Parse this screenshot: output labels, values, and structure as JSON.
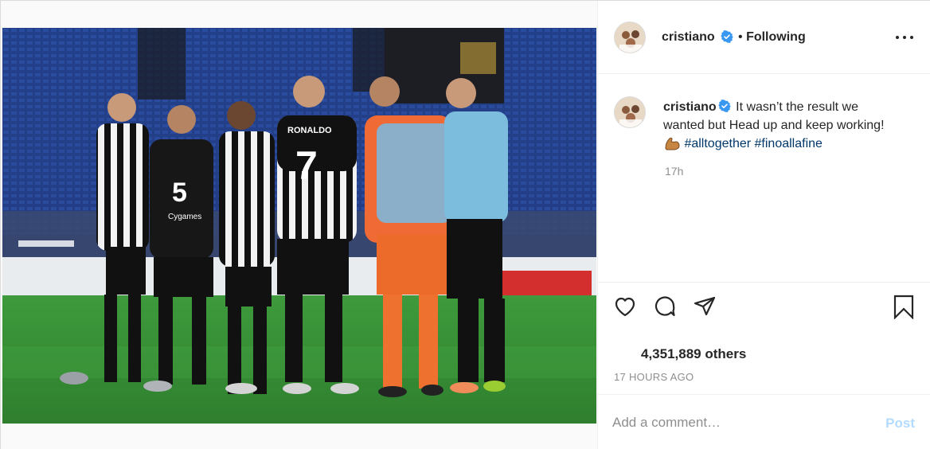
{
  "post": {
    "username": "cristiano",
    "follow_separator": "•",
    "follow_status": "Following",
    "caption": {
      "text_before": "It wasn’t the result we wanted but Head up and keep working!",
      "emoji_icon": "flexed-biceps-icon",
      "hashtags": [
        "#alltogether",
        "#finoallafine"
      ]
    },
    "relative_time": "17h",
    "likes_text": "4,351,889 others",
    "timestamp": "17 HOURS AGO",
    "comment": {
      "placeholder": "Add a comment…",
      "post_label": "Post"
    }
  },
  "photo": {
    "description_icon": "team-celebration-photo",
    "jersey_numbers": [
      "5",
      "7"
    ],
    "jersey_name": "RONALDO",
    "sponsor": "Cygames"
  },
  "icons": {
    "more": "more-options-icon",
    "like": "heart-icon",
    "comment": "comment-icon",
    "share": "share-icon",
    "save": "bookmark-icon",
    "verified": "verified-badge-icon"
  },
  "colors": {
    "hashtag": "#00376b",
    "verified": "#3897f0",
    "post_disabled": "#b3dbff",
    "muted": "#8e8e8e"
  }
}
